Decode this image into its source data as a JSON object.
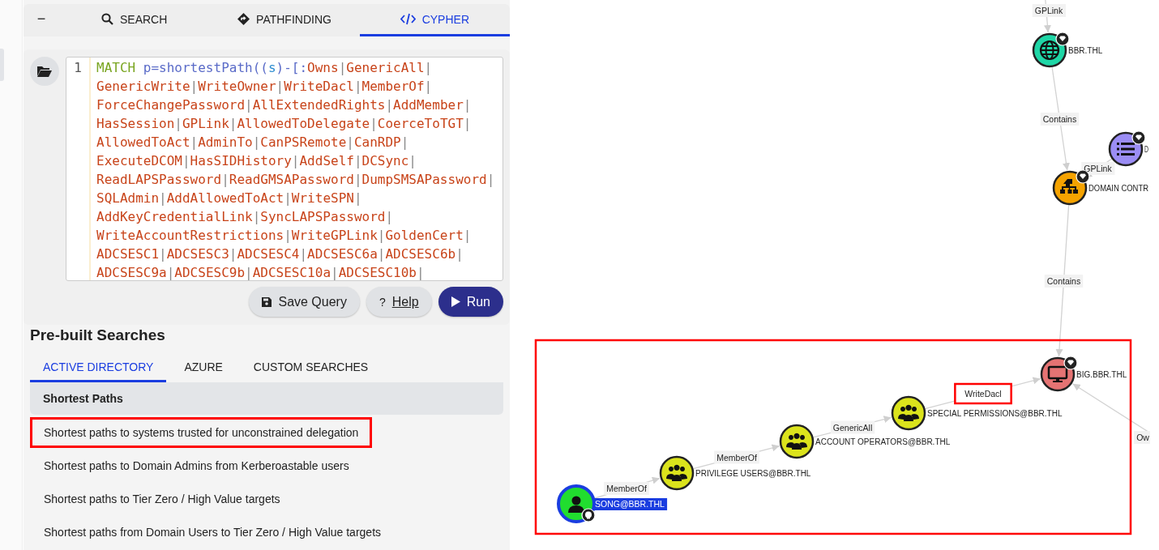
{
  "panel_tabs": [
    {
      "kind": "collapse",
      "label": "−",
      "selected": false
    },
    {
      "kind": "search",
      "label": "SEARCH",
      "selected": false
    },
    {
      "kind": "pathfinding",
      "label": "PATHFINDING",
      "selected": false
    },
    {
      "kind": "cypher",
      "label": "CYPHER",
      "selected": true
    }
  ],
  "editor": {
    "line_number": "1",
    "tokens": [
      {
        "kind": "keyword",
        "text": "MATCH "
      },
      {
        "kind": "function",
        "text": "p=shortestPath(("
      },
      {
        "kind": "variable",
        "text": "s"
      },
      {
        "kind": "function",
        "text": ")-[:"
      }
    ],
    "relations": "Owns|GenericAll|GenericWrite|WriteOwner|WriteDacl|MemberOf|ForceChangePassword|AllExtendedRights|AddMember|HasSession|GPLink|AllowedToDelegate|CoerceToTGT|AllowedToAct|AdminTo|CanPSRemote|CanRDP|ExecuteDCOM|HasSIDHistory|AddSelf|DCSync|ReadLAPSPassword|ReadGMSAPassword|DumpSMSAPassword|SQLAdmin|AddAllowedToAct|WriteSPN|AddKeyCredentialLink|SyncLAPSPassword|WriteAccountRestrictions|WriteGPLink|GoldenCert|ADCSESC1|ADCSESC3|ADCSESC4|ADCSESC6a|ADCSESC6b|ADCSESC9a|ADCSESC9b|ADCSESC10a|ADCSESC10b|"
  },
  "buttons": [
    {
      "kind": "save",
      "label": "Save Query"
    },
    {
      "kind": "help",
      "label": "Help",
      "icon_text": "?"
    },
    {
      "kind": "run",
      "label": "Run"
    }
  ],
  "prebuilt": {
    "title": "Pre-built Searches",
    "tabs": [
      {
        "label": "ACTIVE DIRECTORY",
        "selected": true
      },
      {
        "label": "AZURE",
        "selected": false
      },
      {
        "label": "CUSTOM SEARCHES",
        "selected": false
      }
    ],
    "section": "Shortest Paths",
    "items": [
      {
        "label": "Shortest paths to systems trusted for unconstrained delegation",
        "highlighted": true
      },
      {
        "label": "Shortest paths to Domain Admins from Kerberoastable users",
        "highlighted": false
      },
      {
        "label": "Shortest paths to Tier Zero / High Value targets",
        "highlighted": false
      },
      {
        "label": "Shortest paths from Domain Users to Tier Zero / High Value targets",
        "highlighted": false
      }
    ]
  },
  "graph": {
    "path_highlighted": true,
    "nodes": [
      {
        "label": "BBR.THL",
        "kind": "domain",
        "color": "#1fd6a6",
        "tier_zero": true,
        "owned": false,
        "selected": false
      },
      {
        "label": "D",
        "kind": "gpo",
        "color": "#9b8df5",
        "tier_zero": true,
        "owned": false,
        "selected": false
      },
      {
        "label": "DOMAIN CONTR",
        "kind": "ou",
        "color": "#f5a300",
        "tier_zero": true,
        "owned": false,
        "selected": false
      },
      {
        "label": "BIG.BBR.THL",
        "kind": "computer",
        "color": "#e57373",
        "tier_zero": true,
        "owned": false,
        "selected": false
      },
      {
        "label": "SPECIAL PERMISSIONS@BBR.THL",
        "kind": "group",
        "color": "#dbe31c",
        "tier_zero": false,
        "owned": false,
        "selected": false
      },
      {
        "label": "ACCOUNT OPERATORS@BBR.THL",
        "kind": "group",
        "color": "#dbe31c",
        "tier_zero": false,
        "owned": false,
        "selected": false
      },
      {
        "label": "PRIVILEGE USERS@BBR.THL",
        "kind": "group",
        "color": "#dbe31c",
        "tier_zero": false,
        "owned": false,
        "selected": false
      },
      {
        "label": "SONG@BBR.THL",
        "kind": "user",
        "color": "#21dd2f",
        "tier_zero": false,
        "owned": true,
        "selected": true
      }
    ],
    "edges": [
      {
        "label": "GPLink",
        "highlighted": false
      },
      {
        "label": "Contains",
        "highlighted": false
      },
      {
        "label": "GPLink",
        "highlighted": false
      },
      {
        "label": "Contains",
        "highlighted": false
      },
      {
        "label": "Ow",
        "highlighted": false
      },
      {
        "label": "WriteDacl",
        "highlighted": true
      },
      {
        "label": "GenericAll",
        "highlighted": false
      },
      {
        "label": "MemberOf",
        "highlighted": false
      },
      {
        "label": "MemberOf",
        "highlighted": false
      }
    ]
  }
}
